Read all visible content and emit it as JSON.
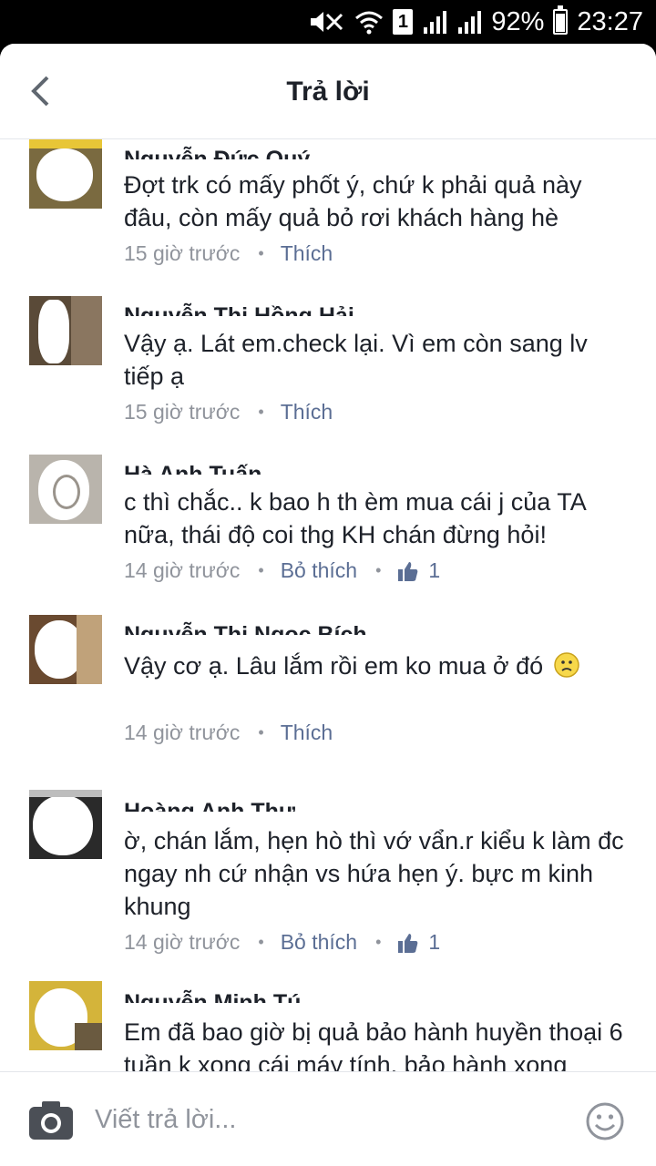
{
  "status_bar": {
    "sim": "1",
    "battery": "92%",
    "battery_level": 0.92,
    "time": "23:27",
    "icons": [
      "mute-icon",
      "wifi-icon",
      "sim-icon",
      "signal-icon",
      "signal-icon",
      "battery-icon"
    ]
  },
  "header": {
    "title": "Trả lời",
    "back_icon": "chevron-left-icon"
  },
  "comments": [
    {
      "name": "Nguyễn Đức Quý",
      "text": "Đợt trk có mấy phốt ý, chứ k phải quả này đâu, còn mấy quả bỏ rơi khách hàng hè",
      "time": "15 giờ trước",
      "action": "Thích"
    },
    {
      "name": "Nguyễn Thị Hồng Hải",
      "text": "Vậy ạ. Lát em.check lại. Vì em còn sang lv tiếp ạ",
      "time": "15 giờ trước",
      "action": "Thích"
    },
    {
      "name": "Hà Anh Tuấn",
      "text": "c thì chắc.. k bao h th èm mua cái j của TA nữa, thái độ coi thg KH chán đừng hỏi!",
      "time": "14 giờ trước",
      "action": "Bỏ thích",
      "likes": "1"
    },
    {
      "name": "Nguyễn Thị Ngọc Bích",
      "text": "Vậy cơ ạ. Lâu lắm rồi em ko mua ở đó",
      "time": "14 giờ trước",
      "action": "Thích",
      "emoji": "slightly-frowning-face-icon"
    },
    {
      "name": "Hoàng Anh Thư",
      "text": "ờ, chán lắm, hẹn hò thì vớ vẩn.r kiểu k làm đc ngay nh cứ nhận vs hứa hẹn ý. bực m kinh  khung",
      "time": "14 giờ trước",
      "action": "Bỏ thích",
      "likes": "1"
    },
    {
      "name": "Nguyễn Minh Tú",
      "text": "Em đã bao giờ bị quả bảo hành huyền thoại 6 tuần k xong cái máy tính, bảo hành xong mang về vẫn bị hỏng, thậm chí nặng",
      "time": "",
      "action": ""
    }
  ],
  "composer": {
    "placeholder": "Viết trả lời...",
    "camera_icon": "camera-icon",
    "emoji_icon": "smiley-icon"
  },
  "colors": {
    "text": "#1d2129",
    "meta": "#90949c",
    "link": "#5b6e94",
    "divider": "#e4e6eb"
  }
}
